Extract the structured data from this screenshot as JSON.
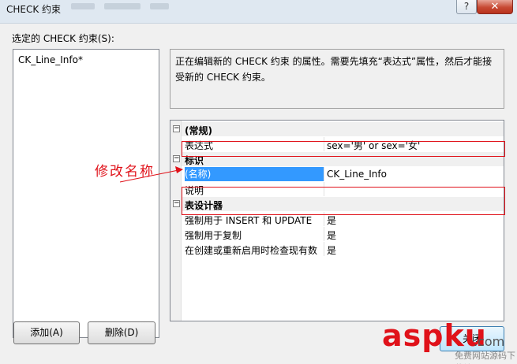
{
  "window": {
    "title": "CHECK 约束",
    "help_label": "?",
    "close_label": "✕"
  },
  "left": {
    "list_label": "选定的 CHECK 约束(S):",
    "items": [
      "CK_Line_Info*"
    ],
    "add_button": "添加(A)",
    "delete_button": "删除(D)"
  },
  "description": "正在编辑新的 CHECK 约束 的属性。需要先填充“表达式”属性，然后才能接受新的 CHECK 约束。",
  "grid": {
    "categories": [
      {
        "label": "(常规)",
        "toggle": "−"
      },
      {
        "label": "标识",
        "toggle": "−"
      },
      {
        "label": "表设计器",
        "toggle": "−"
      }
    ],
    "rows": {
      "expression": {
        "name": "表达式",
        "value": "sex='男' or sex='女'"
      },
      "name": {
        "name": "(名称)",
        "value": "CK_Line_Info"
      },
      "desc": {
        "name": "说明",
        "value": ""
      },
      "enforce_insert_update": {
        "name": "强制用于 INSERT 和 UPDATE",
        "value": "是"
      },
      "enforce_replication": {
        "name": "强制用于复制",
        "value": "是"
      },
      "check_existing": {
        "name": "在创建或重新启用时检查现有数",
        "value": "是"
      }
    }
  },
  "close_button": "关闭",
  "annotation": "修改名称",
  "watermark": {
    "brand": "aspku",
    "suffix": ".com",
    "tagline": "免费网站源码下载站!"
  },
  "colors": {
    "annotation_red": "#e0121a",
    "selection_blue": "#3399ff"
  }
}
